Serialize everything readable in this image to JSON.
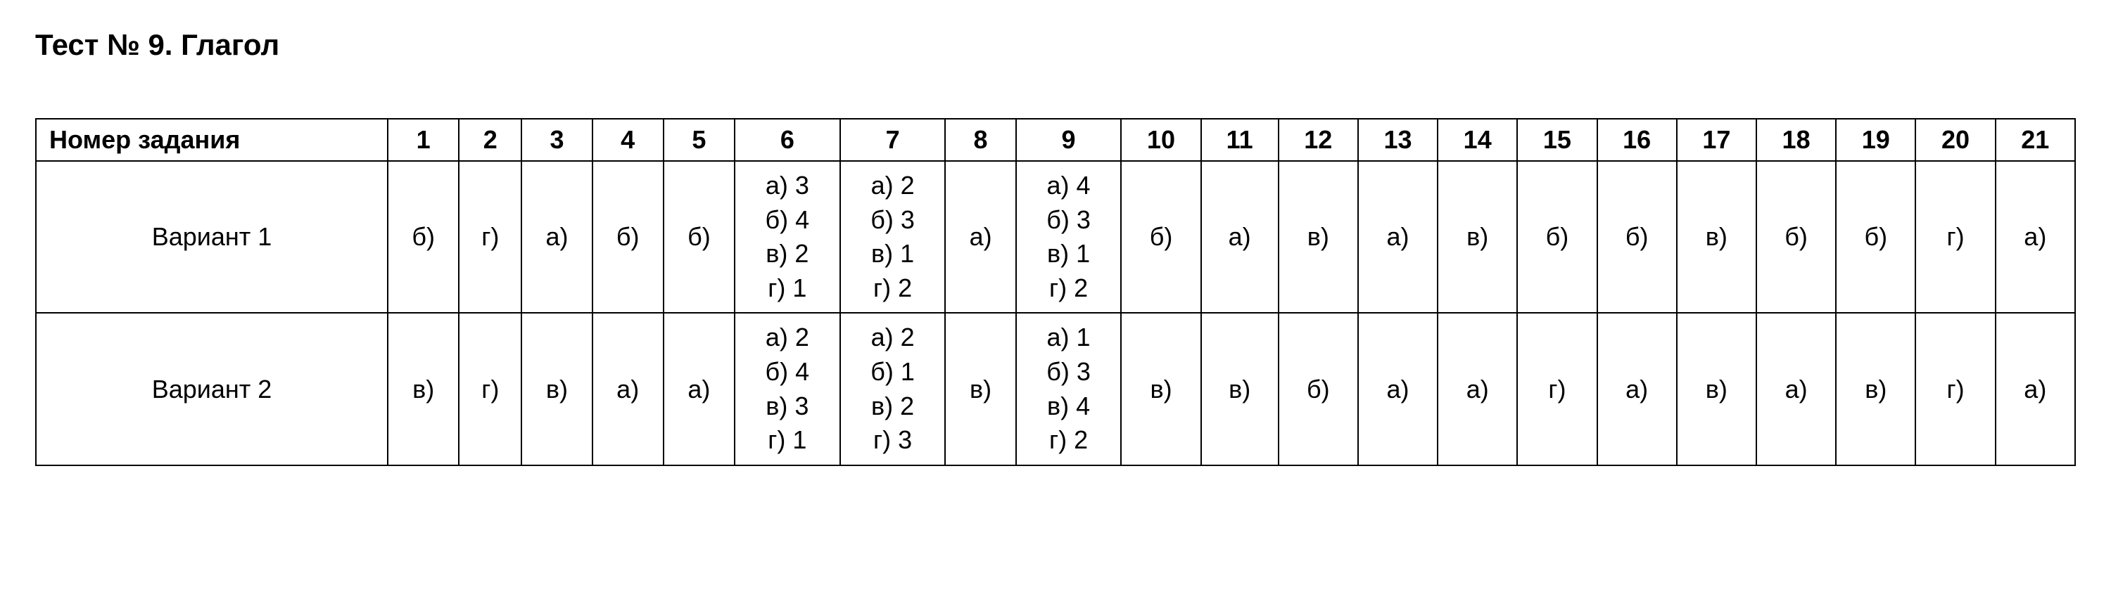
{
  "title": "Тест № 9. Глагол",
  "chart_data": {
    "type": "table",
    "header_label": "Номер задания",
    "columns": [
      "1",
      "2",
      "3",
      "4",
      "5",
      "6",
      "7",
      "8",
      "9",
      "10",
      "11",
      "12",
      "13",
      "14",
      "15",
      "16",
      "17",
      "18",
      "19",
      "20",
      "21"
    ],
    "rows": [
      {
        "label": "Вариант 1",
        "cells": [
          "б)",
          "г)",
          "а)",
          "б)",
          "б)",
          "а) 3\nб) 4\nв) 2\nг) 1",
          "а) 2\nб) 3\nв) 1\nг) 2",
          "а)",
          "а) 4\nб) 3\nв) 1\nг) 2",
          "б)",
          "а)",
          "в)",
          "а)",
          "в)",
          "б)",
          "б)",
          "в)",
          "б)",
          "б)",
          "г)",
          "а)"
        ]
      },
      {
        "label": "Вариант 2",
        "cells": [
          "в)",
          "г)",
          "в)",
          "а)",
          "а)",
          "а) 2\nб) 4\nв) 3\nг) 1",
          "а) 2\nб) 1\nв) 2\nг) 3",
          "в)",
          "а) 1\nб) 3\nв) 4\nг) 2",
          "в)",
          "в)",
          "б)",
          "а)",
          "а)",
          "г)",
          "а)",
          "в)",
          "а)",
          "в)",
          "г)",
          "а)"
        ]
      }
    ]
  }
}
